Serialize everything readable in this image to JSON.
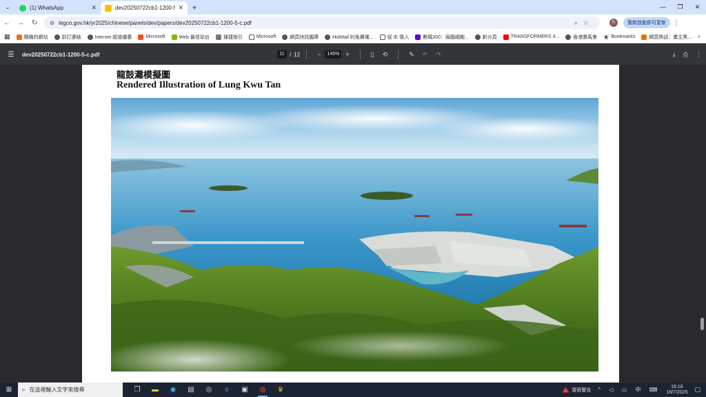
{
  "browser": {
    "tabs": [
      {
        "title": "(1) WhatsApp",
        "icon": "whatsapp-icon",
        "active": false
      },
      {
        "title": "dev20250722cb1-1200-5-c.p",
        "icon": "pdf-file-icon",
        "active": true
      }
    ],
    "url": "legco.gov.hk/yr2025/chinese/panels/dev/papers/dev20250722cb1-1200-5-c.pdf",
    "profile_initial": "h",
    "update_label": "重新啟動即可更新"
  },
  "bookmarks": [
    "隨機的網站",
    "前訂連結",
    "Internet 超值優惠",
    "Microsoft",
    "Web 最佳站台",
    "搜捷指引",
    "Microsoft",
    "網頁快訊圖庫",
    "HotMail 的免費電...",
    "從 IE 匯入",
    "數碼300：兩圖細胞...",
    "新分頁",
    "TRANSFORMERS 4...",
    "香港賽馬會",
    "Bookmarks",
    "網頁熱話：畫主黑..."
  ],
  "pdf": {
    "filename": "dev20250722cb1-1200-5-c.pdf",
    "current_page": "11",
    "total_pages": "12",
    "zoom": "145%",
    "heading_zh": "龍鼓灘模擬圖",
    "heading_en": "Rendered Illustration of Lung Kwu Tan"
  },
  "taskbar": {
    "search_placeholder": "在這裡輸入文字來搜尋",
    "weather_text": "雷雨警告",
    "time": "16:18",
    "date": "18/7/2025",
    "ime": "中"
  }
}
